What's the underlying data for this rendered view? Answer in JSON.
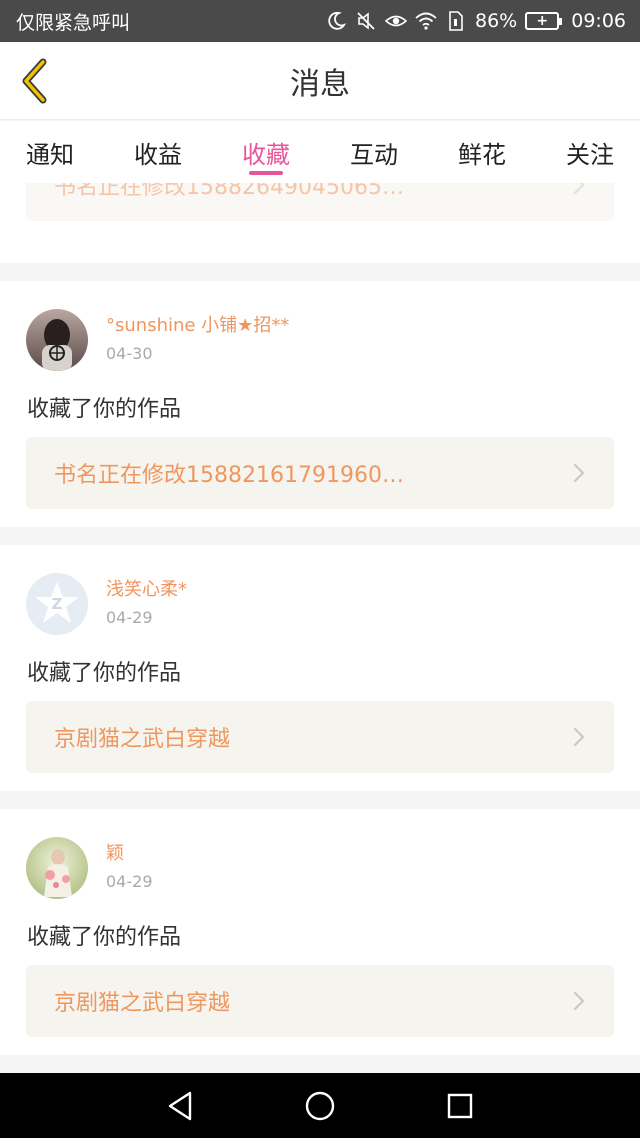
{
  "status_bar": {
    "carrier_text": "仅限紧急呼叫",
    "battery_percent": "86%",
    "time": "09:06",
    "icons": [
      "moon-icon",
      "mute-icon",
      "eye-icon",
      "wifi-icon",
      "sim-icon",
      "battery-icon"
    ]
  },
  "header": {
    "title": "消息",
    "back_icon": "chevron-left-icon"
  },
  "tabs": [
    {
      "label": "通知",
      "active": false
    },
    {
      "label": "收益",
      "active": false
    },
    {
      "label": "收藏",
      "active": true
    },
    {
      "label": "互动",
      "active": false
    },
    {
      "label": "鲜花",
      "active": false
    },
    {
      "label": "关注",
      "active": false
    }
  ],
  "partial_item": {
    "book_title": "书名正在修改15882649045065…"
  },
  "items": [
    {
      "username": "°sunshine 小铺★招**",
      "date": "04-30",
      "action": "收藏了你的作品",
      "book_title": "书名正在修改15882161791960…"
    },
    {
      "username": "浅笑心柔*",
      "date": "04-29",
      "action": "收藏了你的作品",
      "book_title": "京剧猫之武白穿越"
    },
    {
      "username": "颖",
      "date": "04-29",
      "action": "收藏了你的作品",
      "book_title": "京剧猫之武白穿越"
    }
  ],
  "colors": {
    "accent": "#e8559b",
    "username": "#f0955e",
    "book_title": "#f09760",
    "back_arrow": "#e6b800",
    "status_bar": "#4a4a4a"
  },
  "nav_bar": {
    "icons": [
      "back-triangle-icon",
      "home-circle-icon",
      "recents-square-icon"
    ]
  }
}
